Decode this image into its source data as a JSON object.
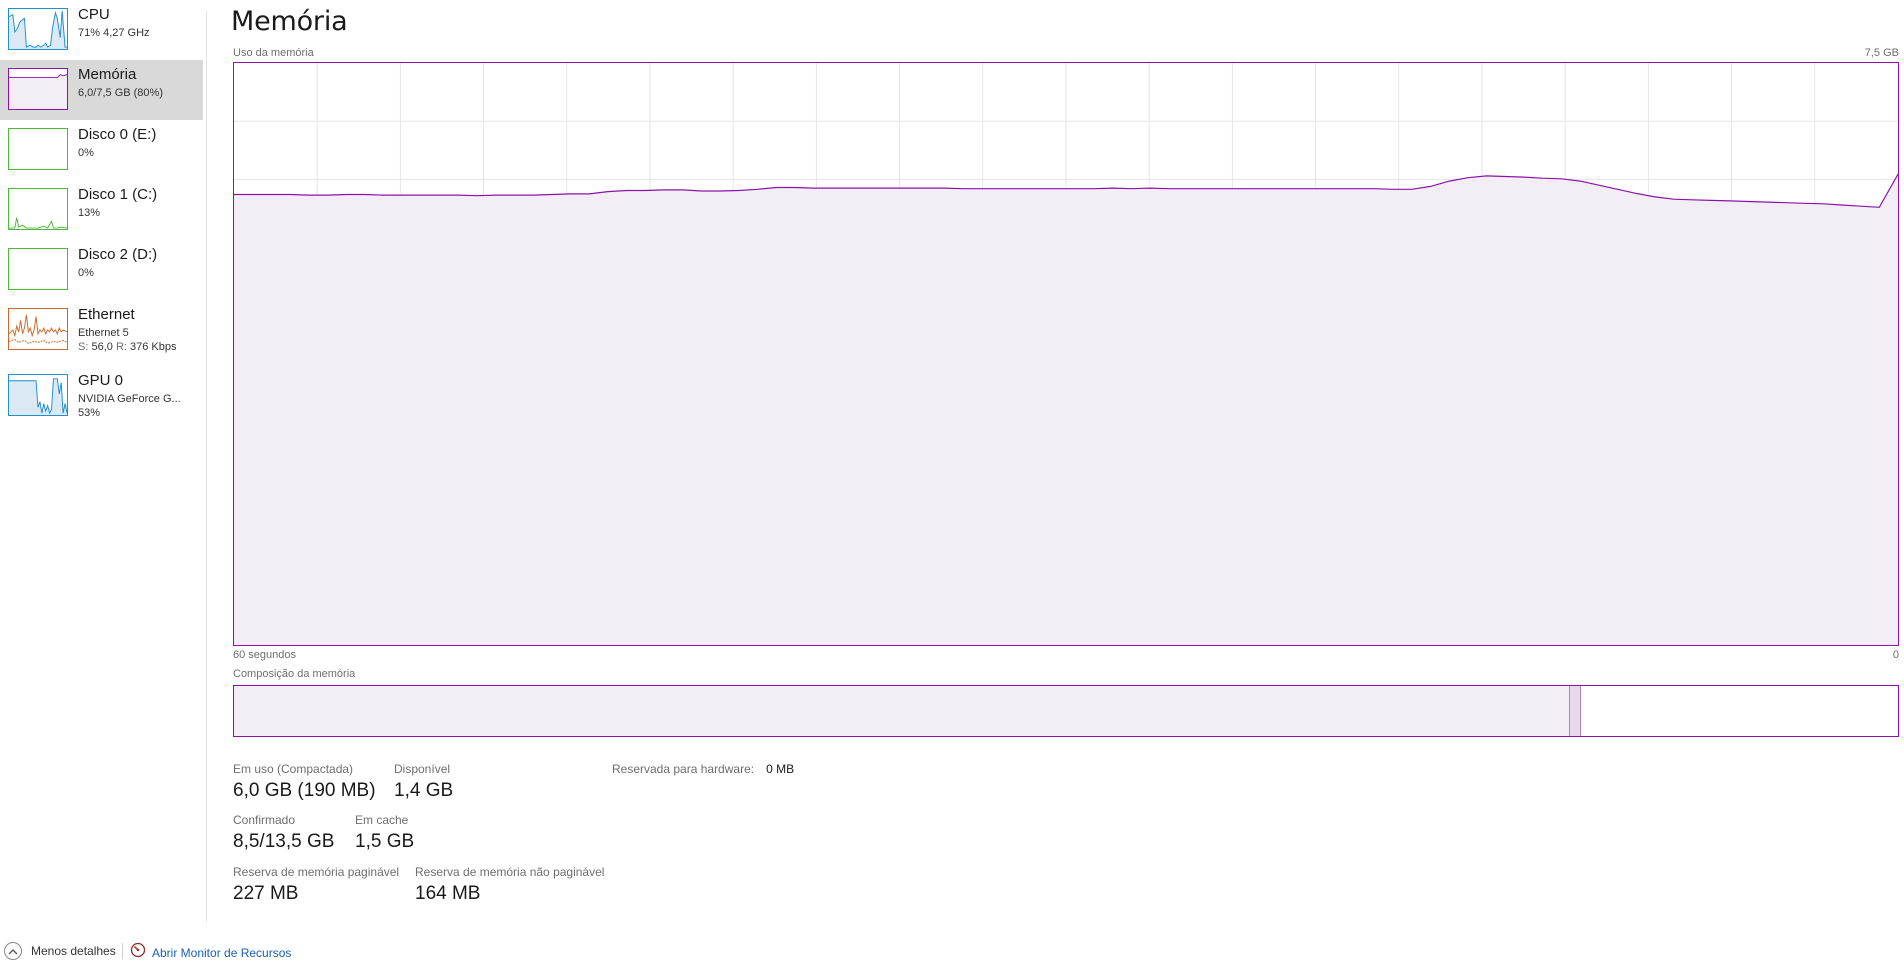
{
  "sidebar": {
    "items": [
      {
        "id": "cpu",
        "title": "CPU",
        "line1": "71% 4,27 GHz",
        "line2": "",
        "color": "#1f8fd0",
        "selected": false
      },
      {
        "id": "memory",
        "title": "Memória",
        "line1": "6,0/7,5 GB (80%)",
        "line2": "",
        "color": "#8b12a8",
        "selected": true
      },
      {
        "id": "disk0",
        "title": "Disco 0 (E:)",
        "line1": "0%",
        "line2": "",
        "color": "#4db83a",
        "selected": false
      },
      {
        "id": "disk1",
        "title": "Disco 1 (C:)",
        "line1": "13%",
        "line2": "",
        "color": "#4db83a",
        "selected": false
      },
      {
        "id": "disk2",
        "title": "Disco 2 (D:)",
        "line1": "0%",
        "line2": "",
        "color": "#4db83a",
        "selected": false
      },
      {
        "id": "ethernet",
        "title": "Ethernet",
        "line1": "Ethernet 5",
        "line2_s_label": "S:",
        "line2_s_value": "56,0",
        "line2_r_label": "R:",
        "line2_r_value": "376 Kbps",
        "color": "#c86b2b",
        "selected": false
      },
      {
        "id": "gpu",
        "title": "GPU 0",
        "line1": "NVIDIA GeForce G...",
        "line2": "53%",
        "color": "#1f8fd0",
        "selected": false
      }
    ]
  },
  "main": {
    "title": "Memória",
    "usage_label": "Uso da memória",
    "usage_max": "7,5 GB",
    "time_span_label": "60 segundos",
    "axis_zero": "0",
    "composition_label": "Composição da memória",
    "composition": {
      "in_use_fraction": 0.8026,
      "modified_fraction": 0.0066
    },
    "stats": {
      "in_use": {
        "label": "Em uso (Compactada)",
        "value": "6,0 GB (190 MB)"
      },
      "available": {
        "label": "Disponível",
        "value": "1,4 GB"
      },
      "hardware_reserved": {
        "label": "Reservada para hardware:",
        "value": "0 MB"
      },
      "committed": {
        "label": "Confirmado",
        "value": "8,5/13,5 GB"
      },
      "cached": {
        "label": "Em cache",
        "value": "1,5 GB"
      },
      "paged_pool": {
        "label": "Reserva de memória paginável",
        "value": "227 MB"
      },
      "nonpaged_pool": {
        "label": "Reserva de memória não paginável",
        "value": "164 MB"
      }
    }
  },
  "footer": {
    "less_details": "Menos detalhes",
    "open_resmon": "Abrir Monitor de Recursos"
  },
  "colors": {
    "memory_accent": "#8b12a8",
    "memory_fill": "#f3eef5",
    "grid": "#e6e6e6",
    "link": "#1a5fb4"
  },
  "chart_data": {
    "type": "area",
    "series": [
      {
        "values": [
          77.4,
          77.4,
          77.4,
          77.4,
          77.3,
          77.3,
          77.4,
          77.4,
          77.3,
          77.3,
          77.3,
          77.3,
          77.3,
          77.2,
          77.3,
          77.3,
          77.3,
          77.4,
          77.5,
          77.5,
          77.9,
          78.1,
          78.1,
          78.2,
          78.2,
          78.0,
          78.0,
          78.1,
          78.3,
          78.6,
          78.6,
          78.5,
          78.5,
          78.5,
          78.5,
          78.5,
          78.5,
          78.5,
          78.5,
          78.4,
          78.4,
          78.4,
          78.4,
          78.4,
          78.4,
          78.4,
          78.4,
          78.5,
          78.4,
          78.5,
          78.4,
          78.4,
          78.4,
          78.4,
          78.4,
          78.4,
          78.4,
          78.4,
          78.4,
          78.4,
          78.4,
          78.4,
          78.3,
          78.3,
          78.8,
          79.7,
          80.3,
          80.6,
          80.5,
          80.4,
          80.2,
          80.1,
          79.7,
          79.0,
          78.3,
          77.6,
          77.0,
          76.6,
          76.5,
          76.4,
          76.3,
          76.2,
          76.1,
          76.0,
          75.9,
          75.8,
          75.6,
          75.4,
          75.2,
          80.9
        ]
      }
    ],
    "ylim": [
      0,
      100
    ],
    "xlim": [
      0,
      60
    ],
    "grid": true
  }
}
